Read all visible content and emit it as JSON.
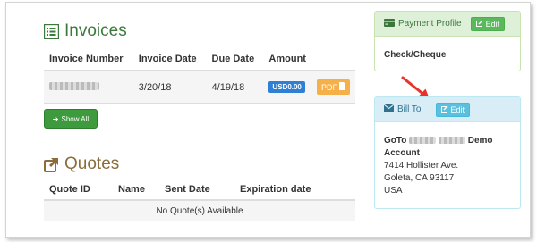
{
  "invoices": {
    "title": "Invoices",
    "columns": [
      "Invoice Number",
      "Invoice Date",
      "Due Date",
      "Amount"
    ],
    "rows": [
      {
        "invoice_date": "3/20/18",
        "due_date": "4/19/18",
        "amount": "USD0.00",
        "pdf_label": "PDF"
      }
    ],
    "show_all_label": "Show All"
  },
  "quotes": {
    "title": "Quotes",
    "columns": [
      "Quote ID",
      "Name",
      "Sent Date",
      "Expiration date"
    ],
    "empty_text": "No Quote(s) Available"
  },
  "payment_profile": {
    "title": "Payment Profile",
    "edit_label": "Edit",
    "method": "Check/Cheque"
  },
  "bill_to": {
    "title": "Bill To",
    "edit_label": "Edit",
    "name_prefix": "GoTo",
    "name_suffix": "Demo",
    "name_line2": "Account",
    "address1": "7414 Hollister Ave.",
    "city_line": "Goleta, CA 93117",
    "country": "USA"
  },
  "colors": {
    "invoices_heading": "#3c7a3c",
    "quotes_heading": "#8a6d3b",
    "amount_badge": "#2f7fd4",
    "pdf_button": "#f5b04a",
    "annotation_arrow": "#e8322b"
  }
}
